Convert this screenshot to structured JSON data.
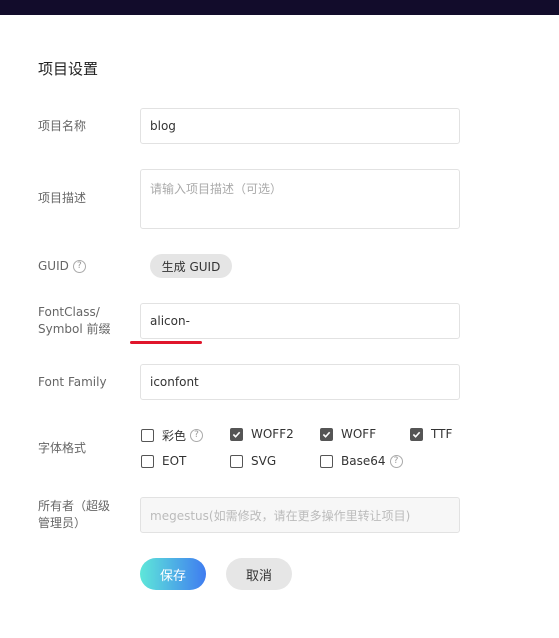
{
  "page": {
    "title": "项目设置"
  },
  "fields": {
    "project_name": {
      "label": "项目名称",
      "value": "blog"
    },
    "project_desc": {
      "label": "项目描述",
      "placeholder": "请输入项目描述（可选）"
    },
    "guid": {
      "label": "GUID",
      "help": "?",
      "button": "生成 GUID"
    },
    "font_class": {
      "label_line1": "FontClass/",
      "label_line2": "Symbol 前缀",
      "value": "alicon-"
    },
    "font_family": {
      "label": "Font Family",
      "value": "iconfont"
    },
    "font_format": {
      "label": "字体格式",
      "options": [
        {
          "label": "彩色",
          "checked": false,
          "help": "?"
        },
        {
          "label": "WOFF2",
          "checked": true
        },
        {
          "label": "WOFF",
          "checked": true
        },
        {
          "label": "TTF",
          "checked": true
        },
        {
          "label": "EOT",
          "checked": false
        },
        {
          "label": "SVG",
          "checked": false
        },
        {
          "label": "Base64",
          "checked": false,
          "help": "?"
        }
      ]
    },
    "owner": {
      "label_line1": "所有者（超级",
      "label_line2": "管理员）",
      "value": "megestus(如需修改，请在更多操作里转让项目)"
    }
  },
  "actions": {
    "save": "保存",
    "cancel": "取消"
  },
  "colors": {
    "accent_start": "#5ee7d9",
    "accent_end": "#3f7cf0",
    "underline": "#e0162b"
  }
}
